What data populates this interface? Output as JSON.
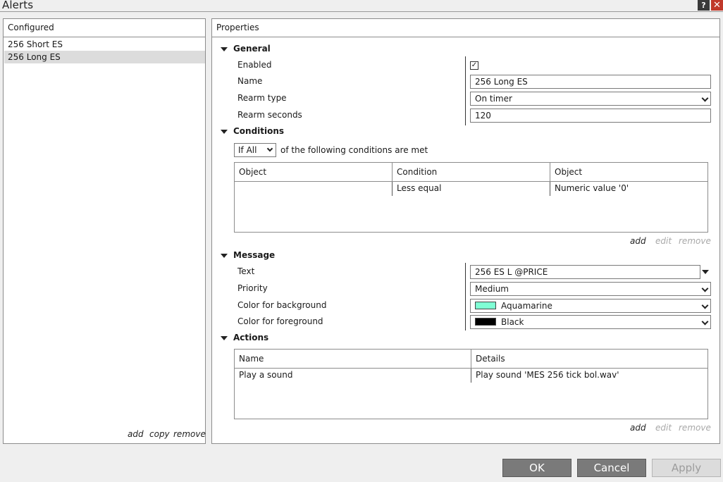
{
  "window": {
    "title": "Alerts",
    "help_glyph": "?",
    "close_glyph": "✕"
  },
  "configured": {
    "header": "Configured",
    "items": [
      {
        "label": "256 Short ES"
      },
      {
        "label": "256 Long ES"
      }
    ],
    "actions": {
      "add": "add",
      "copy": "copy",
      "remove": "remove"
    }
  },
  "properties": {
    "header": "Properties",
    "general": {
      "title": "General",
      "enabled_label": "Enabled",
      "enabled_check": "✓",
      "name_label": "Name",
      "name_value": "256 Long ES",
      "rearm_type_label": "Rearm type",
      "rearm_type_value": "On timer",
      "rearm_seconds_label": "Rearm seconds",
      "rearm_seconds_value": "120"
    },
    "conditions": {
      "title": "Conditions",
      "logic_value": "If All",
      "logic_suffix": "of the following conditions are met",
      "columns": [
        "Object",
        "Condition",
        "Object"
      ],
      "rows": [
        {
          "object": "",
          "condition": "Less equal",
          "target": "Numeric value '0'"
        }
      ],
      "actions": {
        "add": "add",
        "edit": "edit",
        "remove": "remove"
      }
    },
    "message": {
      "title": "Message",
      "text_label": "Text",
      "text_value": "256 ES L  @PRICE",
      "priority_label": "Priority",
      "priority_value": "Medium",
      "bg_label": "Color for background",
      "bg_value": "Aquamarine",
      "bg_color": "#7fffd4",
      "fg_label": "Color for foreground",
      "fg_value": "Black",
      "fg_color": "#000000"
    },
    "actions": {
      "title": "Actions",
      "columns": [
        "Name",
        "Details"
      ],
      "rows": [
        {
          "name": "Play a sound",
          "details": "Play sound 'MES 256 tick bol.wav'"
        }
      ],
      "links": {
        "add": "add",
        "edit": "edit",
        "remove": "remove"
      }
    }
  },
  "buttons": {
    "ok": "OK",
    "cancel": "Cancel",
    "apply": "Apply"
  }
}
